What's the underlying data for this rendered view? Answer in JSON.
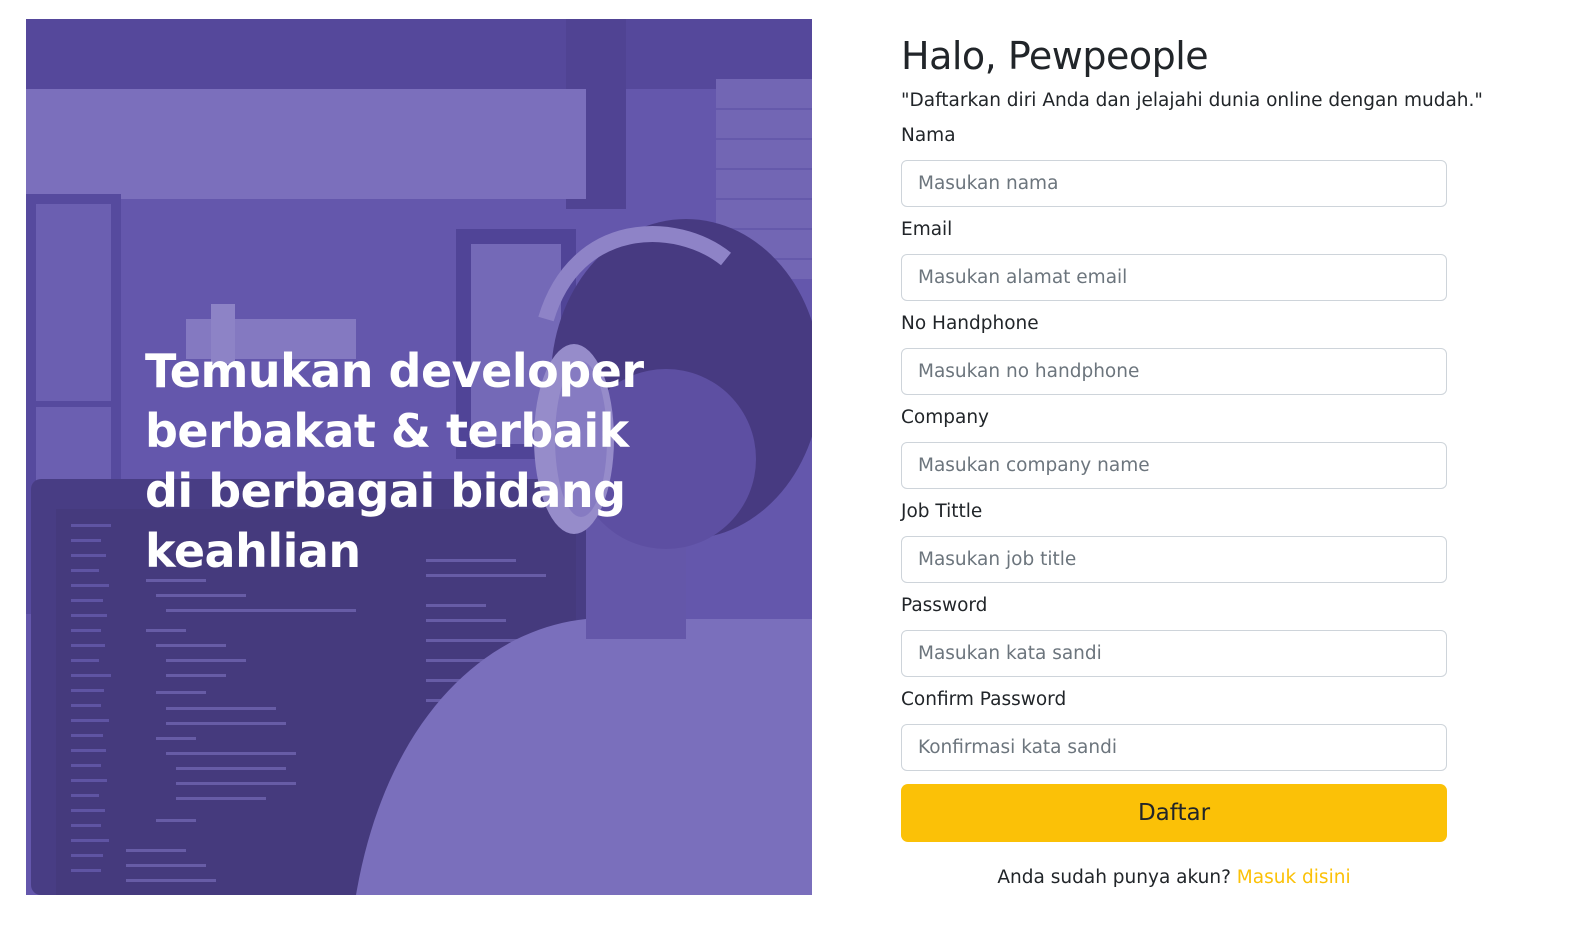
{
  "hero": {
    "title": "Temukan developer berbakat & terbaik di berbagai bidang keahlian"
  },
  "form": {
    "heading": "Halo, Pewpeople",
    "subtitle": "\"Daftarkan diri Anda dan jelajahi dunia online dengan mudah.\"",
    "fields": [
      {
        "label": "Nama",
        "placeholder": "Masukan nama"
      },
      {
        "label": "Email",
        "placeholder": "Masukan alamat email"
      },
      {
        "label": "No Handphone",
        "placeholder": "Masukan no handphone"
      },
      {
        "label": "Company",
        "placeholder": "Masukan company name"
      },
      {
        "label": "Job Tittle",
        "placeholder": "Masukan job title"
      },
      {
        "label": "Password",
        "placeholder": "Masukan kata sandi"
      },
      {
        "label": "Confirm Password",
        "placeholder": "Konfirmasi kata sandi"
      }
    ],
    "submit_label": "Daftar",
    "login_prompt": "Anda sudah punya akun?",
    "login_link": "Masuk disini"
  },
  "colors": {
    "accent": "#fbc107",
    "hero_overlay": "#5e50aa",
    "input_border": "#ced4da",
    "placeholder": "#6c757d"
  }
}
